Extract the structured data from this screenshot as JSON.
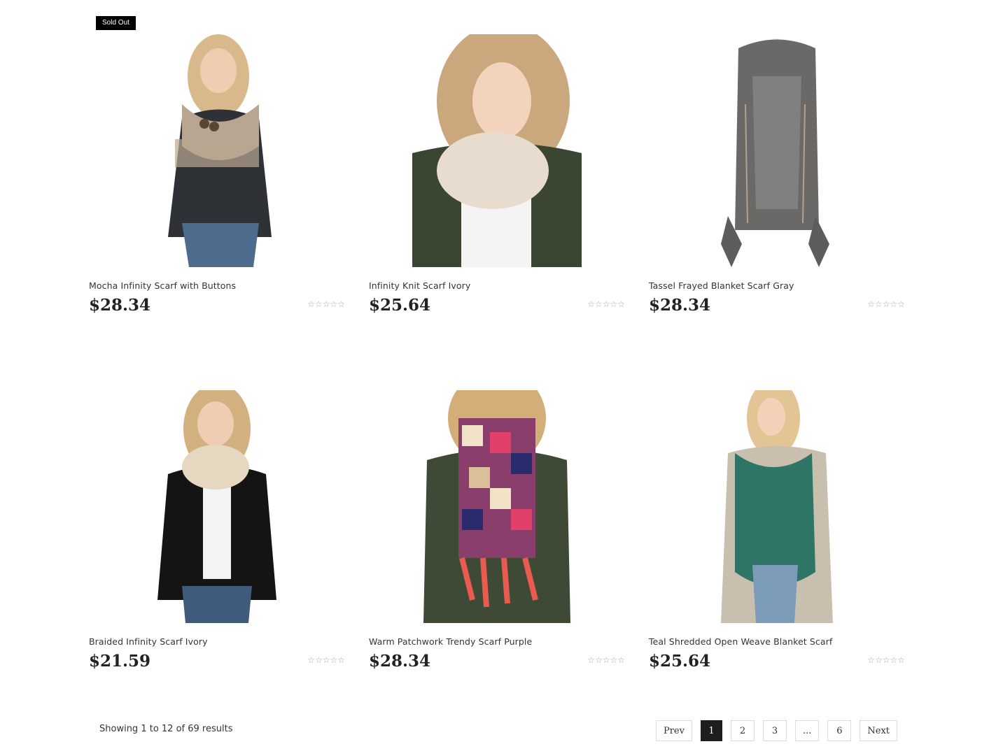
{
  "products": [
    {
      "title": "Mocha Infinity Scarf with Buttons",
      "price": "$28.34",
      "badge": "Sold Out",
      "rating": "☆☆☆☆☆",
      "image": "woman-beige-fringe-infinity-scarf"
    },
    {
      "title": "Infinity Knit Scarf Ivory",
      "price": "$25.64",
      "badge": "",
      "rating": "☆☆☆☆☆",
      "image": "woman-ivory-knit-infinity-scarf"
    },
    {
      "title": "Tassel Frayed Blanket Scarf Gray",
      "price": "$28.34",
      "badge": "",
      "rating": "☆☆☆☆☆",
      "image": "gray-tassel-scarf-on-mannequin"
    },
    {
      "title": "Braided Infinity Scarf Ivory",
      "price": "$21.59",
      "badge": "",
      "rating": "☆☆☆☆☆",
      "image": "woman-ivory-braided-infinity-scarf"
    },
    {
      "title": "Warm Patchwork Trendy Scarf Purple",
      "price": "$28.34",
      "badge": "",
      "rating": "☆☆☆☆☆",
      "image": "woman-patchwork-scarf"
    },
    {
      "title": "Teal Shredded Open Weave Blanket Scarf",
      "price": "$25.64",
      "badge": "",
      "rating": "☆☆☆☆☆",
      "image": "woman-teal-blanket-scarf"
    }
  ],
  "results_text": "Showing 1 to 12 of 69 results",
  "pagination": {
    "prev": "Prev",
    "pages": [
      "1",
      "2",
      "3",
      "...",
      "6"
    ],
    "current": "1",
    "next": "Next"
  },
  "colors": {
    "text": "#222222",
    "badge_bg": "#000000",
    "star": "#a8a8a8",
    "active_page": "#1e1e1e"
  }
}
